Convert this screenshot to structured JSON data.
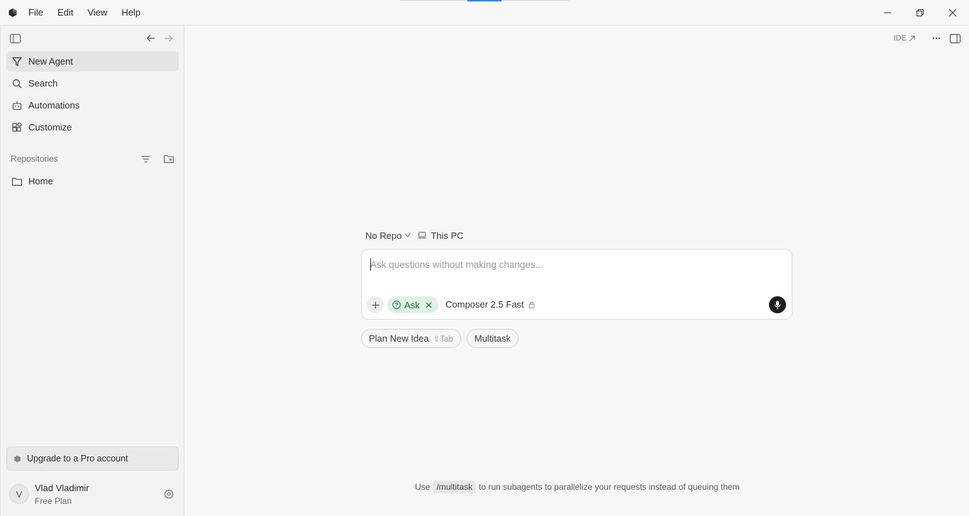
{
  "menu": {
    "items": [
      "File",
      "Edit",
      "View",
      "Help"
    ]
  },
  "sidebar": {
    "nav": [
      {
        "label": "New Agent",
        "icon": "funnel-icon",
        "active": true
      },
      {
        "label": "Search",
        "icon": "search-icon",
        "active": false
      },
      {
        "label": "Automations",
        "icon": "robot-icon",
        "active": false
      },
      {
        "label": "Customize",
        "icon": "blocks-icon",
        "active": false
      }
    ],
    "section_title": "Repositories",
    "repos": [
      {
        "label": "Home",
        "icon": "folder-icon"
      }
    ],
    "upgrade_label": "Upgrade to a Pro account",
    "user": {
      "initial": "V",
      "name": "Vlad Vladimir",
      "plan": "Free Plan"
    }
  },
  "header": {
    "ide_label": "IDE"
  },
  "context": {
    "repo_label": "No Repo",
    "location_label": "This PC"
  },
  "composer": {
    "placeholder": "Ask questions without making changes...",
    "value": "",
    "mode_label": "Ask",
    "model_label": "Composer 2.5 Fast"
  },
  "chips": {
    "plan_label": "Plan New Idea",
    "plan_hint": "⇧Tab",
    "multitask_label": "Multitask"
  },
  "tip": {
    "before": "Use",
    "command": "/multitask",
    "after": "to run subagents to parallelize your requests instead of queuing them"
  },
  "colors": {
    "accent_blue": "#3b82d6",
    "ask_pill_bg": "#dff1e4",
    "ask_pill_fg": "#1f6b3a",
    "mic_bg": "#1e1e1e"
  }
}
